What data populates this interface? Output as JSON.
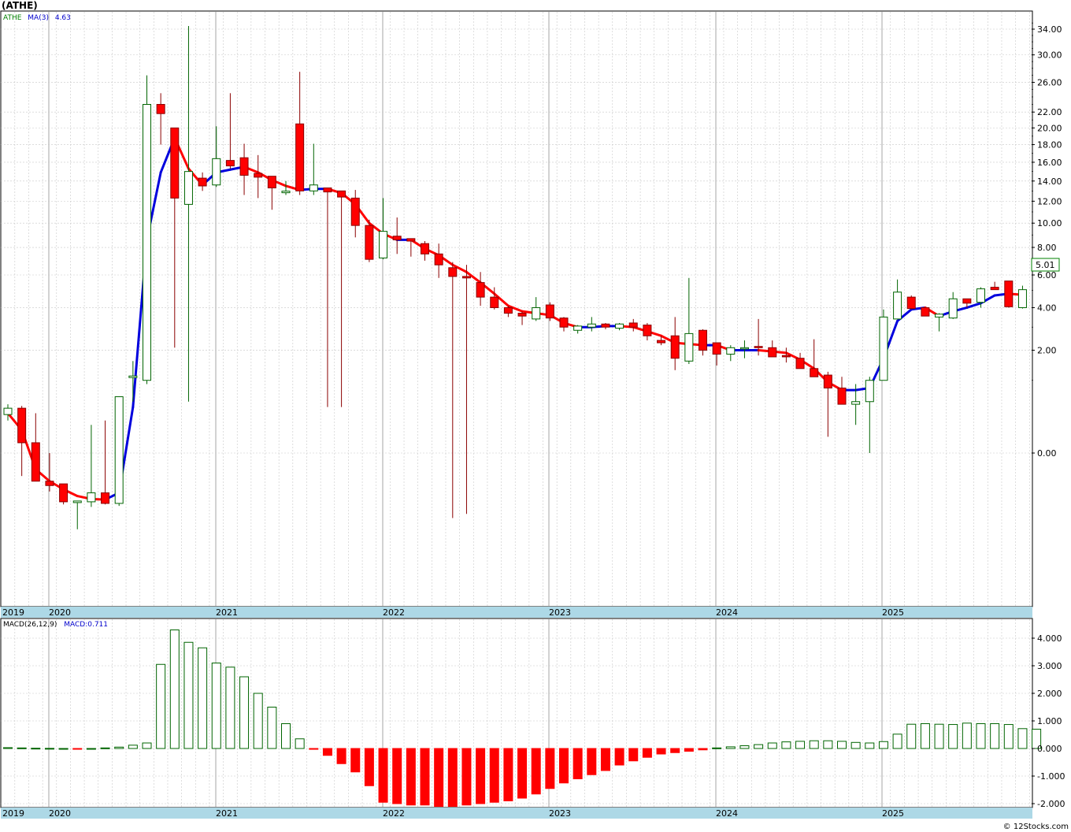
{
  "title": "(ATHE)",
  "price_legend": {
    "symbol": "ATHE",
    "ma_label": "MA(3)",
    "ma_value": "4.63"
  },
  "macd_legend": {
    "label": "MACD(26,12,9)",
    "value_label": "MACD:0.711"
  },
  "last_price_label": "5.01",
  "copyright": "© 12Stocks.com",
  "colors": {
    "up": "#006400",
    "down": "#ff0000",
    "wick_down": "#8b0000",
    "ma_up": "#0000dd",
    "ma_down": "#ff0000",
    "axis_band": "#add8e6",
    "grid": "#c8c8c8",
    "last_price_border": "#008000"
  },
  "chart_data": [
    {
      "type": "candlestick",
      "interval": "monthly",
      "scale": "square-root",
      "grid": true,
      "ylim": [
        -0.8,
        36
      ],
      "ytick_labels": [
        "34.00",
        "30.00",
        "26.00",
        "22.00",
        "20.00",
        "18.00",
        "16.00",
        "14.00",
        "12.00",
        "10.00",
        "8.00",
        "6.00",
        "4.00",
        "2.00",
        "0.00"
      ],
      "xtick_labels": [
        "2019",
        "2020",
        "2021",
        "2022",
        "2023",
        "2024",
        "2025"
      ],
      "ohlc": [
        [
          0.28,
          0.45,
          0.2,
          0.38
        ],
        [
          0.38,
          0.42,
          -0.1,
          0.02
        ],
        [
          0.02,
          0.3,
          -0.15,
          -0.15
        ],
        [
          -0.15,
          0.0,
          -0.28,
          -0.2
        ],
        [
          -0.18,
          -0.18,
          -0.5,
          -0.45
        ],
        [
          -0.45,
          -0.45,
          -1.1,
          -0.45
        ],
        [
          -0.45,
          0.15,
          -0.55,
          -0.3
        ],
        [
          -0.3,
          0.2,
          -0.5,
          -0.48
        ],
        [
          -0.48,
          0.45,
          -0.53,
          0.6
        ],
        [
          1.1,
          1.6,
          0.5,
          1.1
        ],
        [
          1.0,
          27,
          0.9,
          23
        ],
        [
          23,
          24.5,
          18,
          21.8
        ],
        [
          20,
          20,
          2.1,
          12.3
        ],
        [
          11.7,
          34.5,
          0.5,
          15
        ],
        [
          14.3,
          14.9,
          13,
          13.5
        ],
        [
          13.6,
          20.2,
          13.4,
          16.4
        ],
        [
          16.2,
          24.5,
          15.3,
          15.6
        ],
        [
          16.5,
          18.1,
          12.6,
          14.6
        ],
        [
          14.8,
          16.8,
          12.3,
          14.4
        ],
        [
          14.5,
          14.5,
          11.2,
          13.3
        ],
        [
          12.9,
          14,
          12.6,
          12.9
        ],
        [
          20.5,
          27.5,
          12.6,
          13
        ],
        [
          13,
          18.1,
          12.6,
          13.6
        ],
        [
          13.3,
          13.3,
          0.4,
          12.9
        ],
        [
          13,
          13,
          0.4,
          12.4
        ],
        [
          12.3,
          13.1,
          8.8,
          9.8
        ],
        [
          9.8,
          10.3,
          6.9,
          7.1
        ],
        [
          7.2,
          12.3,
          7.1,
          9.3
        ],
        [
          8.9,
          10.5,
          7.5,
          8.6
        ],
        [
          8.7,
          8.6,
          7.3,
          8.5
        ],
        [
          8.3,
          8.5,
          7.0,
          7.5
        ],
        [
          7.5,
          8.3,
          5.8,
          6.7
        ],
        [
          6.5,
          6.9,
          -0.8,
          5.9
        ],
        [
          5.9,
          6.7,
          -0.7,
          5.8
        ],
        [
          5.5,
          6.2,
          4.1,
          4.6
        ],
        [
          4.6,
          5.2,
          3.9,
          4.0
        ],
        [
          4.0,
          4.1,
          3.5,
          3.7
        ],
        [
          3.7,
          3.8,
          3.1,
          3.55
        ],
        [
          3.4,
          4.6,
          3.3,
          4.0
        ],
        [
          4.15,
          4.3,
          3.3,
          3.45
        ],
        [
          3.45,
          3.5,
          2.8,
          3.0
        ],
        [
          2.85,
          3.1,
          2.7,
          3.05
        ],
        [
          3.0,
          3.5,
          2.8,
          3.15
        ],
        [
          3.15,
          3.2,
          2.9,
          3.0
        ],
        [
          2.95,
          3.2,
          2.85,
          3.15
        ],
        [
          3.2,
          3.4,
          2.8,
          3.0
        ],
        [
          3.1,
          3.2,
          2.4,
          2.6
        ],
        [
          2.4,
          2.6,
          2.2,
          2.3
        ],
        [
          2.6,
          3.5,
          1.3,
          1.7
        ],
        [
          1.6,
          5.8,
          1.5,
          2.7
        ],
        [
          2.85,
          2.9,
          1.8,
          2.0
        ],
        [
          2.3,
          2.3,
          1.45,
          1.85
        ],
        [
          1.85,
          2.2,
          1.6,
          2.1
        ],
        [
          2.05,
          2.4,
          1.7,
          2.1
        ],
        [
          2.15,
          3.4,
          1.8,
          2.1
        ],
        [
          2.1,
          2.4,
          1.85,
          1.75
        ],
        [
          1.8,
          2.1,
          1.55,
          1.75
        ],
        [
          1.7,
          1.9,
          1.35,
          1.35
        ],
        [
          1.35,
          2.45,
          1.3,
          1.1
        ],
        [
          1.15,
          1.25,
          0.05,
          0.8
        ],
        [
          0.8,
          1.1,
          0.45,
          0.45
        ],
        [
          0.45,
          0.9,
          0.15,
          0.5
        ],
        [
          0.5,
          1.1,
          0.0,
          1.0
        ],
        [
          1.0,
          3.9,
          1.0,
          3.5
        ],
        [
          3.4,
          5.7,
          3.4,
          4.9
        ],
        [
          4.6,
          4.7,
          3.9,
          3.95
        ],
        [
          4.0,
          4.0,
          3.6,
          3.55
        ],
        [
          3.5,
          3.7,
          2.8,
          3.65
        ],
        [
          3.45,
          4.9,
          3.4,
          4.5
        ],
        [
          4.5,
          4.5,
          4.0,
          4.25
        ],
        [
          4.3,
          5.2,
          4.0,
          5.1
        ],
        [
          5.2,
          5.55,
          5.1,
          5.05
        ],
        [
          5.6,
          5.6,
          4.0,
          4.05
        ],
        [
          4.0,
          5.3,
          3.95,
          5.05
        ]
      ],
      "ma3": [
        0.3,
        0.1,
        -0.05,
        -0.15,
        -0.25,
        -0.35,
        -0.4,
        -0.41,
        -0.3,
        0.4,
        8.6,
        14.9,
        18.8,
        15.3,
        13.6,
        14.9,
        15.2,
        15.5,
        14.9,
        14.1,
        13.5,
        13.1,
        13.2,
        13.2,
        12.8,
        11.7,
        10.0,
        9.1,
        8.6,
        8.6,
        7.9,
        7.4,
        6.7,
        6.2,
        5.5,
        4.8,
        4.1,
        3.8,
        3.7,
        3.6,
        3.2,
        3.0,
        3.0,
        3.05,
        3.05,
        3.0,
        2.8,
        2.6,
        2.3,
        2.25,
        2.2,
        2.2,
        2.0,
        2.0,
        2.0,
        1.95,
        1.9,
        1.65,
        1.35,
        0.95,
        0.75,
        0.75,
        0.8,
        1.7,
        3.3,
        3.9,
        4.0,
        3.55,
        3.8,
        4.0,
        4.25,
        4.7,
        4.8,
        4.74
      ],
      "macd_hist": [
        0.03,
        0.02,
        0.01,
        0.005,
        0.0,
        -0.005,
        0.0,
        0.02,
        0.05,
        0.12,
        0.2,
        3.05,
        4.3,
        3.85,
        3.65,
        3.1,
        2.95,
        2.6,
        2.0,
        1.5,
        0.9,
        0.35,
        -0.03,
        -0.25,
        -0.55,
        -0.85,
        -1.35,
        -1.95,
        -2.0,
        -2.05,
        -2.05,
        -2.1,
        -2.1,
        -2.05,
        -2.0,
        -1.95,
        -1.9,
        -1.8,
        -1.65,
        -1.45,
        -1.25,
        -1.1,
        -0.95,
        -0.8,
        -0.6,
        -0.45,
        -0.32,
        -0.2,
        -0.15,
        -0.1,
        -0.05,
        0.02,
        0.06,
        0.1,
        0.14,
        0.2,
        0.24,
        0.26,
        0.28,
        0.28,
        0.26,
        0.22,
        0.2,
        0.25,
        0.52,
        0.88,
        0.9,
        0.88,
        0.87,
        0.92,
        0.9,
        0.9,
        0.87,
        0.72,
        0.7
      ]
    }
  ]
}
